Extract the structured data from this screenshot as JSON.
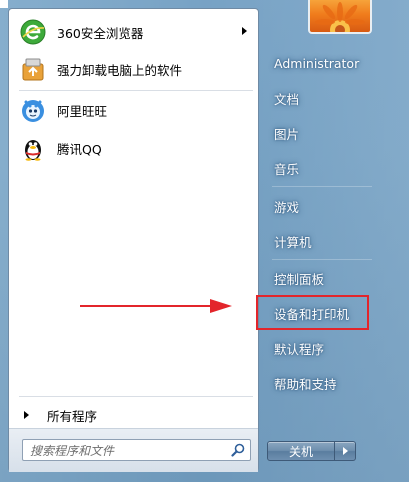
{
  "programs": [
    {
      "label": "360安全浏览器",
      "icon": "360-browser-icon",
      "has_submenu": true
    },
    {
      "label": "强力卸载电脑上的软件",
      "icon": "uninstall-icon",
      "has_submenu": false
    },
    {
      "label": "阿里旺旺",
      "icon": "aliwangwang-icon",
      "has_submenu": false
    },
    {
      "label": "腾讯QQ",
      "icon": "qq-penguin-icon",
      "has_submenu": false
    }
  ],
  "all_programs_label": "所有程序",
  "search": {
    "placeholder": "搜索程序和文件"
  },
  "right_menu": {
    "user": "Administrator",
    "documents": "文档",
    "pictures": "图片",
    "music": "音乐",
    "games": "游戏",
    "computer": "计算机",
    "control_panel": "控制面板",
    "devices_printers": "设备和打印机",
    "default_programs": "默认程序",
    "help_support": "帮助和支持"
  },
  "shutdown": {
    "label": "关机"
  },
  "colors": {
    "highlight_border": "#e3252b",
    "arrow": "#e3252b",
    "menu_text": "#ffffff"
  }
}
